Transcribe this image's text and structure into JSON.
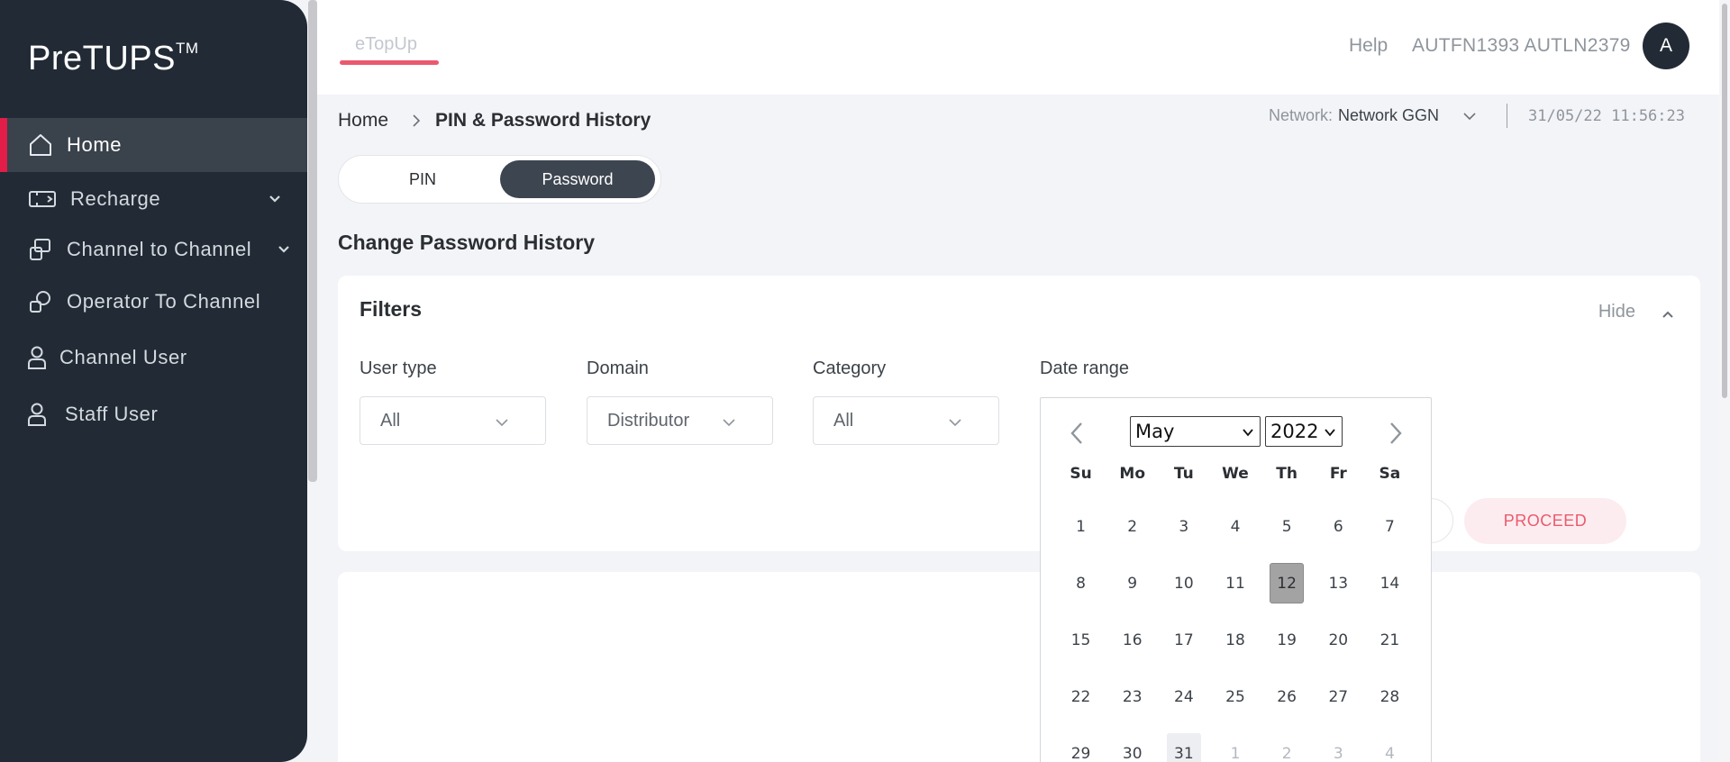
{
  "app": {
    "brand": "PreTUPS",
    "brand_mark": "TM"
  },
  "sidebar": {
    "items": [
      {
        "label": "Home",
        "icon": "home-icon",
        "active": true
      },
      {
        "label": "Recharge",
        "icon": "recharge-icon",
        "has_submenu": true
      },
      {
        "label": "Channel to Channel",
        "icon": "channel-to-channel-icon",
        "has_submenu": true
      },
      {
        "label": "Operator To Channel",
        "icon": "operator-to-channel-icon"
      },
      {
        "label": "Channel User",
        "icon": "user-icon"
      },
      {
        "label": "Staff User",
        "icon": "user-icon"
      }
    ]
  },
  "header": {
    "tab": "eTopUp",
    "help": "Help",
    "username": "AUTFN1393 AUTLN2379",
    "avatar_initial": "A"
  },
  "breadcrumb": {
    "home": "Home",
    "current": "PIN & Password History"
  },
  "network": {
    "label": "Network:",
    "value": "Network GGN"
  },
  "datetime": "31/05/22 11:56:23",
  "toggle": {
    "pin": "PIN",
    "password": "Password",
    "selected": "Password"
  },
  "section_title": "Change Password History",
  "filters": {
    "title": "Filters",
    "hide": "Hide",
    "user_type": {
      "label": "User type",
      "value": "All"
    },
    "domain": {
      "label": "Domain",
      "value": "Distributor"
    },
    "category": {
      "label": "Category",
      "value": "All"
    },
    "date_range": {
      "label": "Date range"
    },
    "proceed": "PROCEED"
  },
  "datepicker": {
    "month": "May",
    "year": "2022",
    "weekdays": [
      "Su",
      "Mo",
      "Tu",
      "We",
      "Th",
      "Fr",
      "Sa"
    ],
    "days": [
      {
        "d": "1"
      },
      {
        "d": "2"
      },
      {
        "d": "3"
      },
      {
        "d": "4"
      },
      {
        "d": "5"
      },
      {
        "d": "6"
      },
      {
        "d": "7"
      },
      {
        "d": "8"
      },
      {
        "d": "9"
      },
      {
        "d": "10"
      },
      {
        "d": "11"
      },
      {
        "d": "12",
        "selected": true
      },
      {
        "d": "13"
      },
      {
        "d": "14"
      },
      {
        "d": "15"
      },
      {
        "d": "16"
      },
      {
        "d": "17"
      },
      {
        "d": "18"
      },
      {
        "d": "19"
      },
      {
        "d": "20"
      },
      {
        "d": "21"
      },
      {
        "d": "22"
      },
      {
        "d": "23"
      },
      {
        "d": "24"
      },
      {
        "d": "25"
      },
      {
        "d": "26"
      },
      {
        "d": "27"
      },
      {
        "d": "28"
      },
      {
        "d": "29"
      },
      {
        "d": "30"
      },
      {
        "d": "31",
        "today": true
      },
      {
        "d": "1",
        "muted": true
      },
      {
        "d": "2",
        "muted": true
      },
      {
        "d": "3",
        "muted": true
      },
      {
        "d": "4",
        "muted": true
      }
    ]
  },
  "colors": {
    "sidebar_bg": "#222b35",
    "accent": "#e11d48",
    "proceed_bg": "#fdecef",
    "toggle_active": "#3d4550"
  }
}
